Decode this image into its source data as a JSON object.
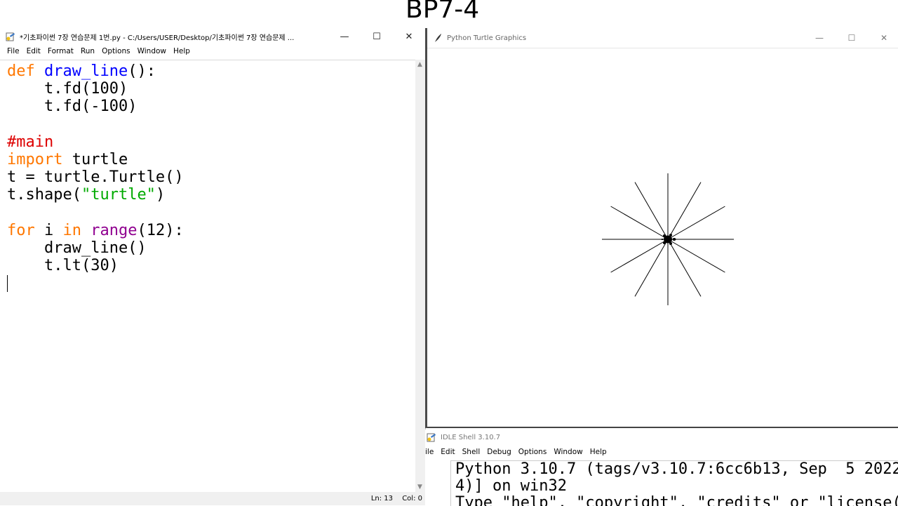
{
  "slide": {
    "title": "BP7-4"
  },
  "editor": {
    "title": "*기초파이썬 7장 연습문제 1번.py - C:/Users/USER/Desktop/기초파이썬 7장 연습문제 ...",
    "controls": {
      "minimize": "—",
      "maximize": "☐",
      "close": "✕"
    },
    "menu": [
      "File",
      "Edit",
      "Format",
      "Run",
      "Options",
      "Window",
      "Help"
    ],
    "code": {
      "l1_kw": "def",
      "l1_fn": "draw_line",
      "l1_rest": "():",
      "l2": "    t.fd(100)",
      "l3": "    t.fd(-100)",
      "l5": "#main",
      "l6_kw": "import",
      "l6_rest": " turtle",
      "l7": "t = turtle.Turtle()",
      "l8_pre": "t.shape(",
      "l8_str": "\"turtle\"",
      "l8_post": ")",
      "l10_kw1": "for",
      "l10_mid": " i ",
      "l10_kw2": "in",
      "l10_sp": " ",
      "l10_bi": "range",
      "l10_rest": "(12):",
      "l11": "    draw_line()",
      "l12": "    t.lt(30)"
    },
    "status": {
      "line": "Ln: 13",
      "col": "Col: 0"
    }
  },
  "turtle_window": {
    "title": "Python Turtle Graphics",
    "controls": {
      "minimize": "—",
      "maximize": "☐",
      "close": "✕"
    },
    "drawing": {
      "lines": 12,
      "line_length": 100,
      "turn_angle": 30,
      "stroke_color": "#000000"
    }
  },
  "shell": {
    "title": "IDLE Shell 3.10.7",
    "menu": [
      "ile",
      "Edit",
      "Shell",
      "Debug",
      "Options",
      "Window",
      "Help"
    ],
    "lines": [
      "Python 3.10.7 (tags/v3.10.7:6cc6b13, Sep  5 2022",
      "4)] on win32",
      "Type \"help\", \"copyright\", \"credits\" or \"license("
    ]
  }
}
